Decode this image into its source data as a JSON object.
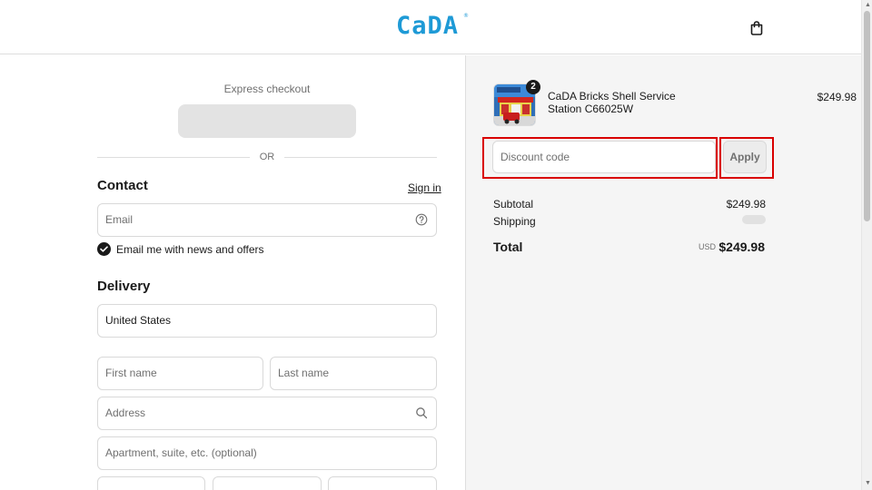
{
  "header": {
    "logo_text": "CaDA",
    "logo_mark": "®",
    "cart_icon": "shopping-bag-icon"
  },
  "checkout": {
    "express_label": "Express checkout",
    "or_label": "OR",
    "contact": {
      "title": "Contact",
      "signin_label": "Sign in",
      "email_placeholder": "Email",
      "email_help_icon": "question-circle-icon",
      "newsletter_label": "Email me with news and offers",
      "newsletter_checked": true
    },
    "delivery": {
      "title": "Delivery",
      "country_value": "United States",
      "first_name_placeholder": "First name",
      "last_name_placeholder": "Last name",
      "address_placeholder": "Address",
      "address_search_icon": "search-icon",
      "apartment_placeholder": "Apartment, suite, etc. (optional)"
    }
  },
  "summary": {
    "product": {
      "name": "CaDA Bricks Shell Service Station C66025W",
      "price": "$249.98",
      "quantity": "2"
    },
    "discount_placeholder": "Discount code",
    "apply_label": "Apply",
    "subtotal_label": "Subtotal",
    "subtotal_value": "$249.98",
    "shipping_label": "Shipping",
    "total_label": "Total",
    "total_currency": "USD",
    "total_value": "$249.98"
  },
  "colors": {
    "brand": "#1e9ad6",
    "highlight_outline": "#d90000",
    "summary_bg": "#f5f5f5"
  }
}
